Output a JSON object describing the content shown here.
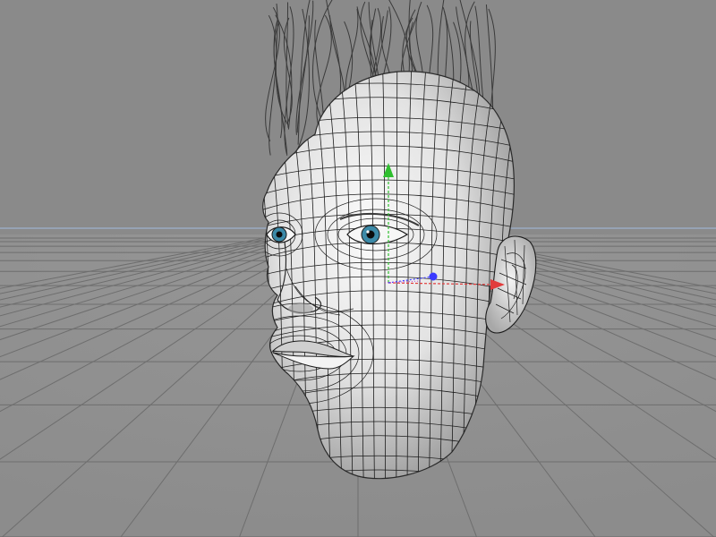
{
  "viewport": {
    "background": "#8a8a8a",
    "floor_color": "#929292",
    "grid_line_color": "#6e6e6e",
    "horizon_line_color": "#9aa9c2"
  },
  "model": {
    "object": "head-mesh",
    "skin_color": "#e9e9e9",
    "skin_shadow_color": "#9c9c9c",
    "wire_color": "#1c1c1c",
    "hair_guide_color": "#3a3a3a",
    "iris_color": "#3c8aa8"
  },
  "gizmo": {
    "x_axis_color": "#e23b3b",
    "y_axis_color": "#2fbf2f",
    "z_axis_color": "#3a3aff"
  }
}
